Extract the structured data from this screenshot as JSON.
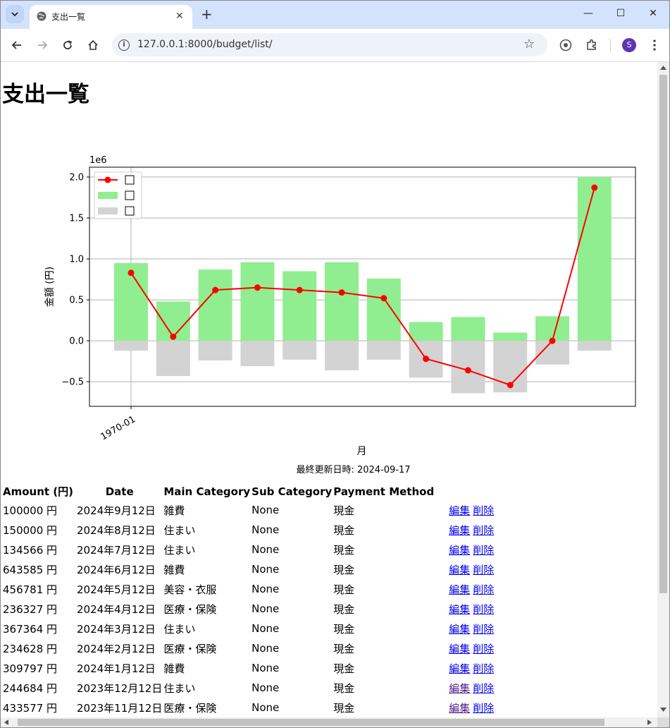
{
  "browser": {
    "tab_title": "支出一覧",
    "url": "127.0.0.1:8000/budget/list/",
    "profile_initial": "S"
  },
  "page": {
    "title": "支出一覧",
    "last_updated": "最終更新日時: 2024-09-17"
  },
  "chart_data": {
    "type": "bar",
    "title": "",
    "xlabel": "月",
    "ylabel": "金額 (円)",
    "y_scale_label": "1e6",
    "ylim": [
      -0.8,
      2.12
    ],
    "y_ticks": [
      -0.5,
      0.0,
      0.5,
      1.0,
      1.5,
      2.0
    ],
    "y_tick_labels": [
      "−0.5",
      "0.0",
      "0.5",
      "1.0",
      "1.5",
      "2.0"
    ],
    "x_tick_labels": [
      "1970-01"
    ],
    "grid": true,
    "legend_position": "top-left",
    "legend_entries": [
      {
        "label": "",
        "kind": "line",
        "color": "#ff0000"
      },
      {
        "label": "",
        "kind": "bar",
        "color": "#90ee90"
      },
      {
        "label": "",
        "kind": "bar",
        "color": "#d3d3d3"
      }
    ],
    "series": [
      {
        "name": "",
        "kind": "bar",
        "color": "#90ee90",
        "values": [
          0.95,
          0.48,
          0.87,
          0.96,
          0.85,
          0.96,
          0.76,
          0.23,
          0.29,
          0.1,
          0.3,
          2.0
        ]
      },
      {
        "name": "",
        "kind": "bar",
        "color": "#d3d3d3",
        "values": [
          -0.12,
          -0.43,
          -0.24,
          -0.31,
          -0.23,
          -0.36,
          -0.23,
          -0.45,
          -0.64,
          -0.63,
          -0.29,
          -0.12
        ]
      },
      {
        "name": "",
        "kind": "line",
        "color": "#ff0000",
        "values": [
          0.83,
          0.05,
          0.62,
          0.65,
          0.62,
          0.59,
          0.52,
          -0.22,
          -0.36,
          -0.54,
          0.0,
          1.87
        ]
      }
    ]
  },
  "table": {
    "headers": [
      "Amount (円)",
      "Date",
      "Main Category",
      "Sub Category",
      "Payment Method",
      ""
    ],
    "edit_label": "編集",
    "delete_label": "削除",
    "rows": [
      [
        "100000 円",
        "2024年9月12日",
        "雑費",
        "None",
        "現金"
      ],
      [
        "150000 円",
        "2024年8月12日",
        "住まい",
        "None",
        "現金"
      ],
      [
        "134566 円",
        "2024年7月12日",
        "住まい",
        "None",
        "現金"
      ],
      [
        "643585 円",
        "2024年6月12日",
        "雑費",
        "None",
        "現金"
      ],
      [
        "456781 円",
        "2024年5月12日",
        "美容・衣服",
        "None",
        "現金"
      ],
      [
        "236327 円",
        "2024年4月12日",
        "医療・保険",
        "None",
        "現金"
      ],
      [
        "367364 円",
        "2024年3月12日",
        "住まい",
        "None",
        "現金"
      ],
      [
        "234628 円",
        "2024年2月12日",
        "医療・保険",
        "None",
        "現金"
      ],
      [
        "309797 円",
        "2024年1月12日",
        "雑費",
        "None",
        "現金"
      ],
      [
        "244684 円",
        "2023年12月12日",
        "住まい",
        "None",
        "現金"
      ],
      [
        "433577 円",
        "2023年11月12日",
        "医療・保険",
        "None",
        "現金"
      ]
    ]
  }
}
